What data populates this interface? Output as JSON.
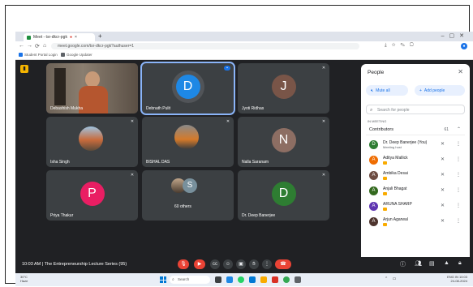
{
  "browser": {
    "tab_title": "Meet - tsr-dkcr-pgk",
    "rec_icon": "record-icon",
    "address": "meet.google.com/tsr-dkcr-pgk?authuser=1",
    "bookmarks": [
      "Student Portal Login",
      "Google Updater"
    ]
  },
  "meeting": {
    "time": "10:03 AM",
    "separator": "|",
    "title": "The Entrepreneurship Lecture Series (95)"
  },
  "tiles": [
    {
      "name": "Debashish Mukha",
      "kind": "video"
    },
    {
      "name": "Debnath Pulit",
      "kind": "avatar",
      "initial": "D",
      "color": "#1e88e5"
    },
    {
      "name": "Jyoti Ridhas",
      "kind": "avatar",
      "initial": "J",
      "color": "#795548"
    },
    {
      "name": "Isha Singh",
      "kind": "photo"
    },
    {
      "name": "BISHAL DAS",
      "kind": "photo"
    },
    {
      "name": "Nalla Saranam",
      "kind": "avatar",
      "initial": "N",
      "color": "#8d6e63"
    },
    {
      "name": "Priya Thakur",
      "kind": "avatar",
      "initial": "P",
      "color": "#e91e63"
    },
    {
      "name": "60 others",
      "kind": "group",
      "initial": "S"
    },
    {
      "name": "Dr. Deep Banerjee",
      "kind": "avatar",
      "initial": "D",
      "color": "#2e7d32"
    }
  ],
  "people_panel": {
    "title": "People",
    "mute_all": "Mute all",
    "add_people": "Add people",
    "search_placeholder": "Search for people",
    "in_meeting": "IN MEETING",
    "contributors_label": "Contributors",
    "contributors_count": "61",
    "people": [
      {
        "name": "Dr. Deep Banerjee (You)",
        "sub": "Meeting host",
        "initial": "D",
        "color": "#2e7d32"
      },
      {
        "name": "Aditya Mallick",
        "sub": "",
        "initial": "A",
        "color": "#ef6c00"
      },
      {
        "name": "Ambika Desai",
        "sub": "",
        "initial": "A",
        "color": "#6d4c41"
      },
      {
        "name": "Anjali Bhagat",
        "sub": "",
        "initial": "A",
        "color": "#33691e"
      },
      {
        "name": "ARUNA SHARP",
        "sub": "",
        "initial": "A",
        "color": "#5e35b1"
      },
      {
        "name": "Arjun Agarwal",
        "sub": "",
        "initial": "A",
        "color": "#4e342e"
      }
    ]
  },
  "taskbar": {
    "weather_temp": "30°C",
    "weather_desc": "Haze",
    "search": "Search",
    "lang": "ENG IN",
    "clock_time": "10:03",
    "clock_date": "24-08-2024"
  }
}
